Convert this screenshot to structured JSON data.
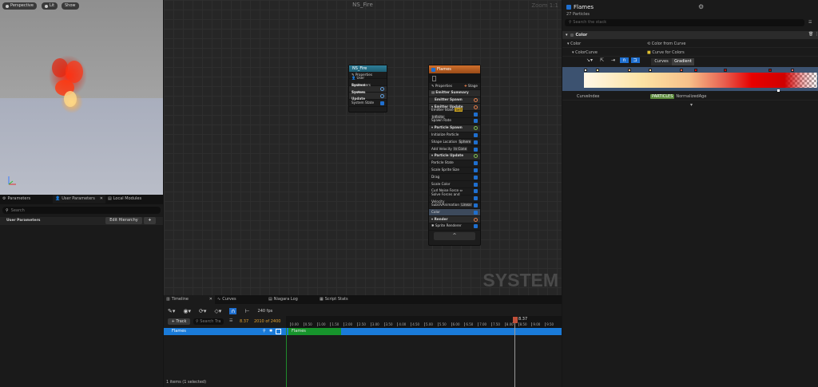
{
  "viewport": {
    "buttons": [
      "Perspective",
      "Lit",
      "Show"
    ]
  },
  "left_panel": {
    "tabs": [
      "Parameters",
      "User Parameters",
      "Local Modules"
    ],
    "search_placeholder": "Search",
    "section_label": "User Parameters",
    "edit_hierarchy": "Edit Hierarchy",
    "add": "+"
  },
  "graph": {
    "title": "NS_Fire",
    "zoom": "Zoom 1:1",
    "watermark": "SYSTEM",
    "system_node": {
      "title": "NS_Fire",
      "rows": [
        "Properties",
        "User Parameters",
        "System Spawn",
        "System Update",
        "System State"
      ]
    },
    "emitter_node": {
      "title": "Flames",
      "properties": "Properties",
      "stage": "Stage",
      "emitter_summary": "Emitter Summary",
      "emitter_spawn": "Emitter Spawn",
      "emitter_update": "Emitter Update",
      "emitter_state": "Emitter State",
      "self_tag": "Self",
      "infinite": "Infinite",
      "spawn_rate": "Spawn Rate",
      "particle_spawn": "Particle Spawn",
      "initialize_particle": "Initialize Particle",
      "shape_location": "Shape Location",
      "sphere": "Sphere",
      "add_velocity": "Add Velocity",
      "in_cone": "In Cone",
      "particle_update": "Particle Update",
      "update_rows": [
        "Particle State",
        "Scale Sprite Size",
        "Drag",
        "Scale Color",
        "Curl Noise Force",
        "Solve Forces and Velocity",
        "SubUVAnimation",
        "Color"
      ],
      "linear": "Linear",
      "render": "Render",
      "sprite_renderer": "Sprite Renderer"
    }
  },
  "timeline": {
    "tabs": [
      "Timeline",
      "Curves",
      "Niagara Log",
      "Script Stats"
    ],
    "fps": "240 fps",
    "track_btn": "+ Track",
    "search_placeholder": "Search Tra",
    "time": "8.37",
    "frames": "2010 of 2400",
    "track_name": "Flames",
    "bar_label": "Flames",
    "ticks": [
      "0.00",
      "0.50",
      "1.00",
      "1.50",
      "2.00",
      "2.50",
      "3.00",
      "3.50",
      "4.00",
      "4.50",
      "5.00",
      "5.50",
      "6.00",
      "6.50",
      "7.00",
      "7.50",
      "8.00",
      "8.50",
      "9.00",
      "9.50"
    ],
    "playhead": "8.37",
    "status": "1 items (1 selected)"
  },
  "details": {
    "title": "Flames",
    "subtitle": "27 Particles",
    "search_placeholder": "Search the stack",
    "section": "Color",
    "row_color": "Color",
    "color_value": "Color from Curve",
    "row_colorcurve": "ColorCurve",
    "curve_value": "Curve for Colors",
    "btn_curves": "Curves",
    "btn_gradient": "Gradient",
    "row_curveindex": "CurveIndex",
    "particles_tag": "PARTICLES",
    "normalized_age": "NormalizedAge"
  }
}
